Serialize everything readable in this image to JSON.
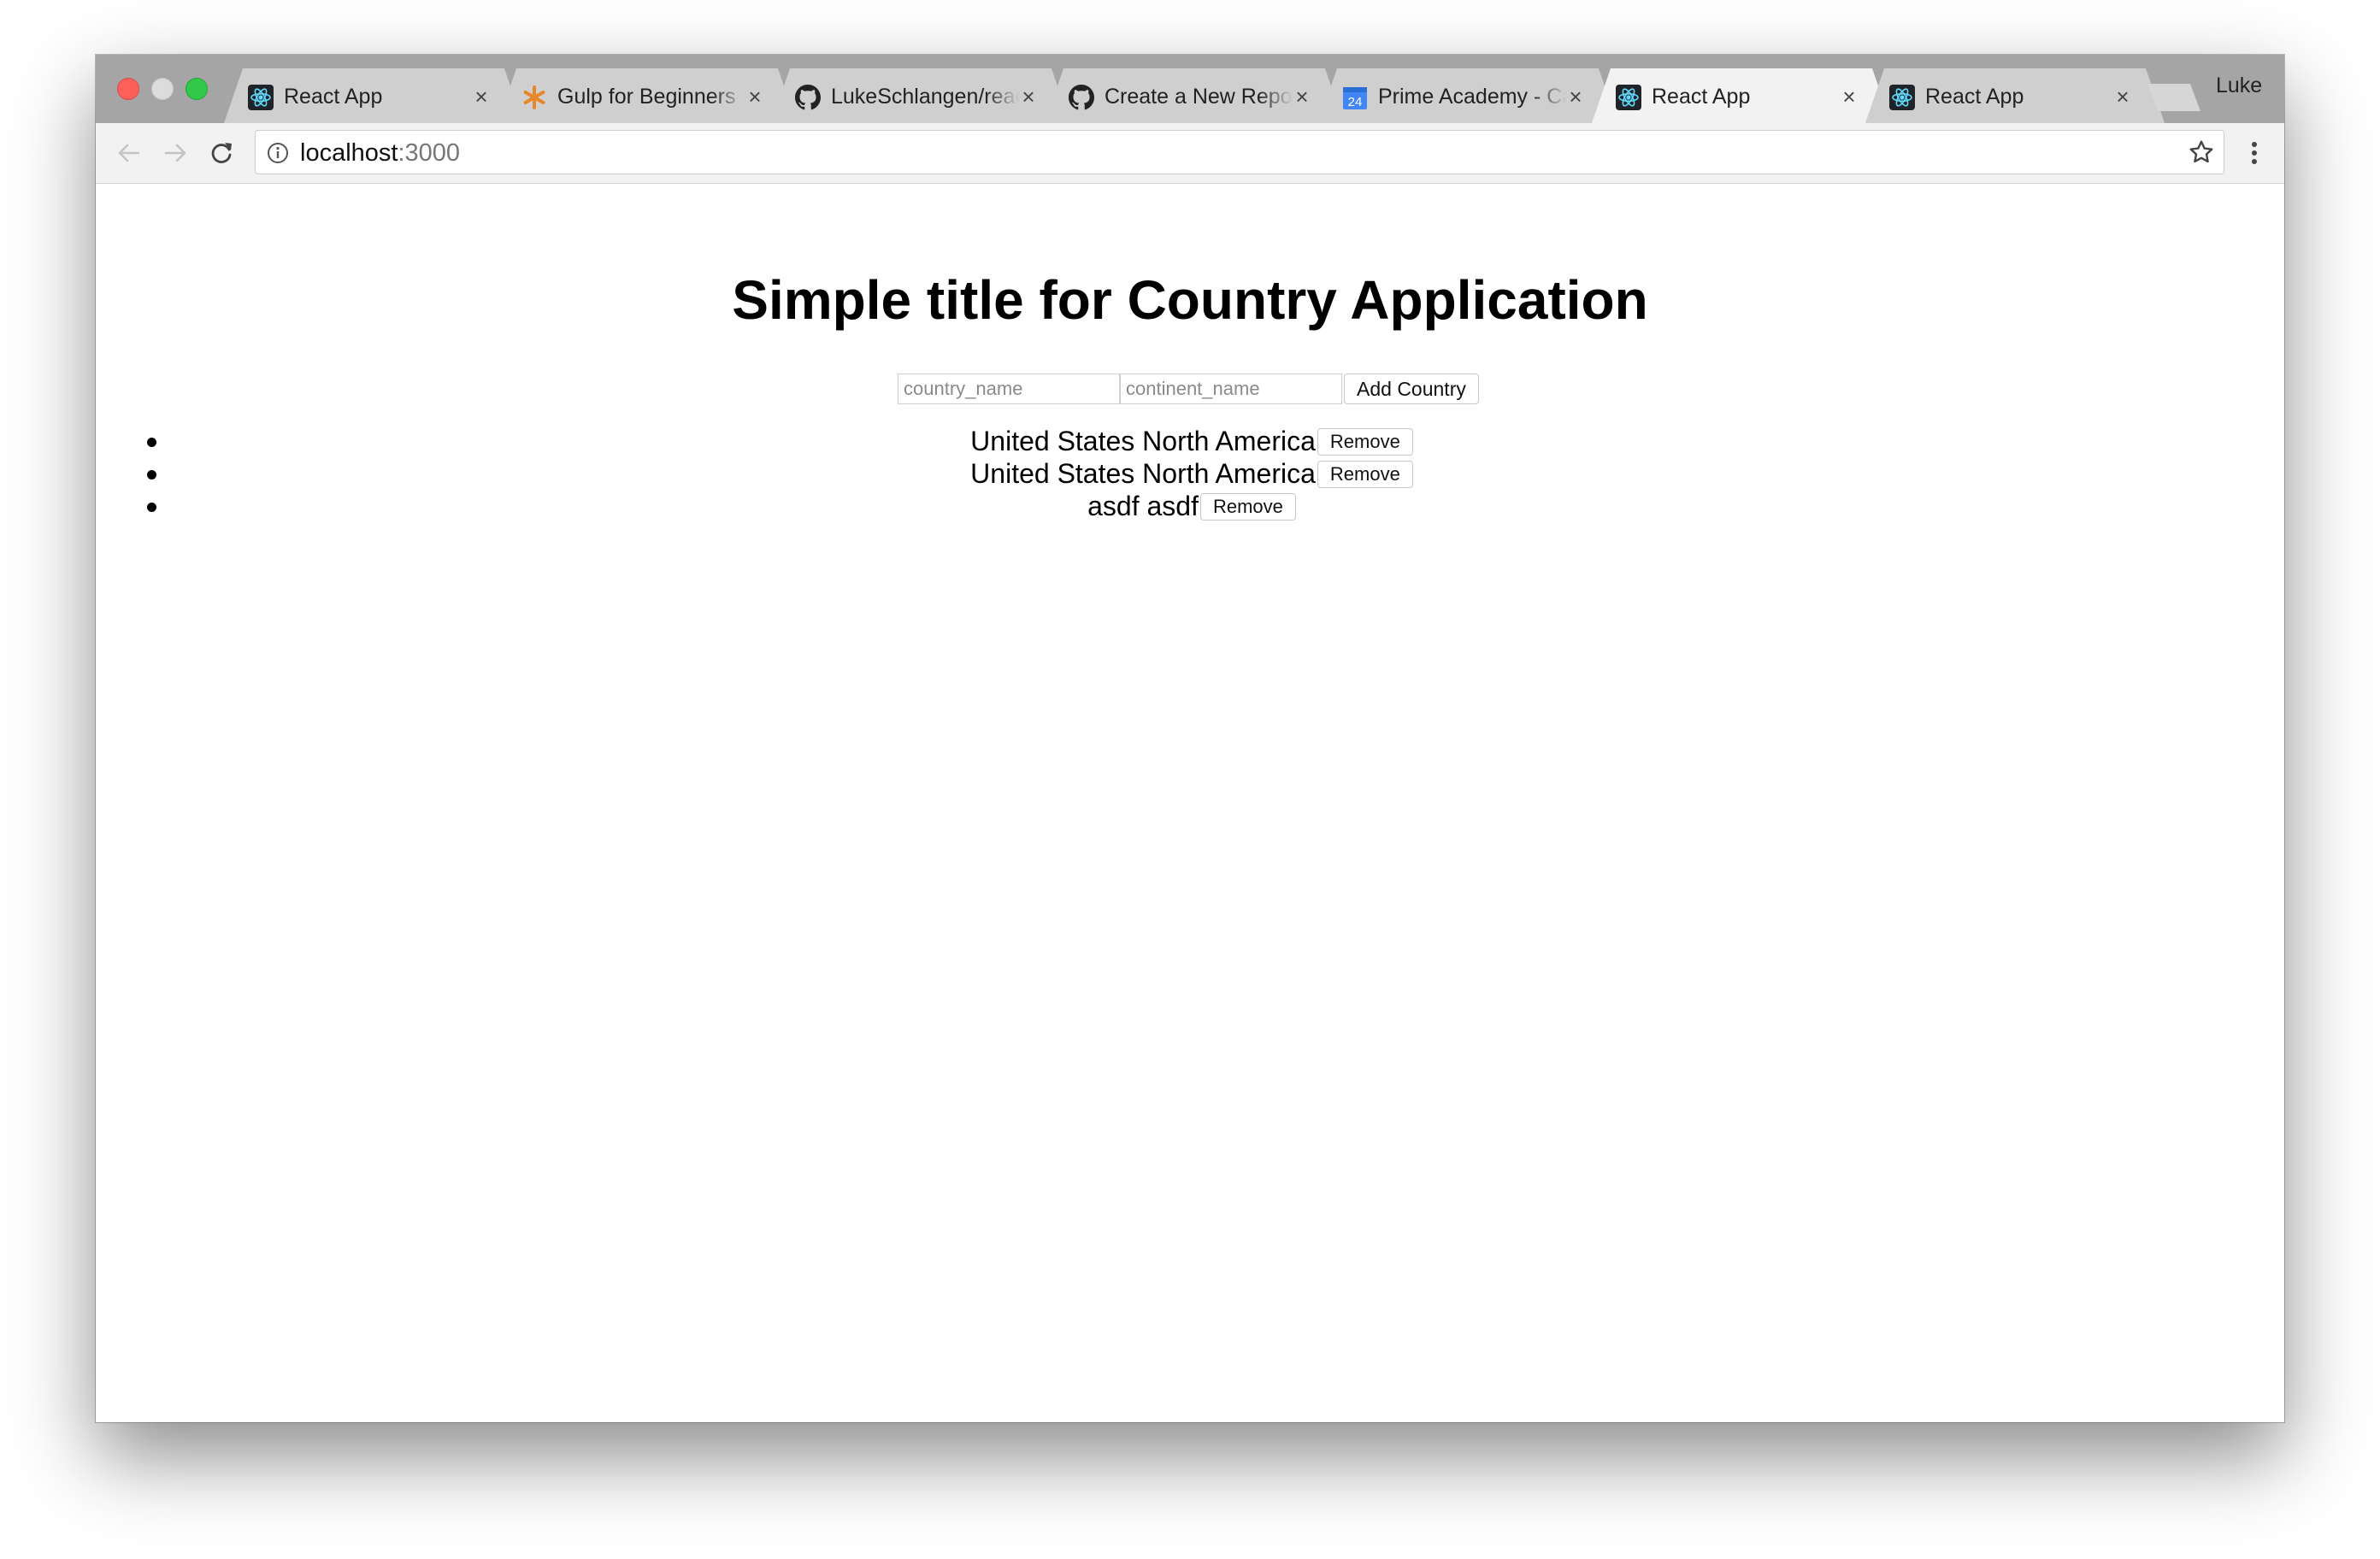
{
  "browser": {
    "tabs": [
      {
        "title": "React App",
        "favicon": "react-icon",
        "active": false
      },
      {
        "title": "Gulp for Beginners",
        "favicon": "asterisk-icon",
        "active": false
      },
      {
        "title": "LukeSchlangen/react",
        "favicon": "github-icon",
        "active": false
      },
      {
        "title": "Create a New Repository",
        "favicon": "github-icon",
        "active": false
      },
      {
        "title": "Prime Academy - Calendar",
        "favicon": "calendar-icon",
        "active": false
      },
      {
        "title": "React App",
        "favicon": "react-icon",
        "active": true
      },
      {
        "title": "React App",
        "favicon": "react-icon",
        "active": false
      }
    ],
    "calendar_day": "24",
    "profile_name": "Luke",
    "url_host": "localhost",
    "url_port": ":3000"
  },
  "page": {
    "title": "Simple title for Country Application",
    "form": {
      "country_placeholder": "country_name",
      "continent_placeholder": "continent_name",
      "add_button": "Add Country"
    },
    "countries": [
      {
        "country": "United States",
        "continent": "North America",
        "remove_label": "Remove"
      },
      {
        "country": "United States",
        "continent": "North America",
        "remove_label": "Remove"
      },
      {
        "country": "asdf",
        "continent": "asdf",
        "remove_label": "Remove"
      }
    ]
  },
  "colors": {
    "react": "#61dafb",
    "gulp": "#e8862a",
    "calendar": "#4285f4"
  }
}
